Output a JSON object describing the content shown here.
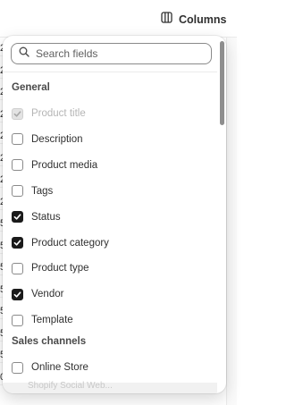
{
  "toolbar": {
    "columns_label": "Columns",
    "columns_icon": "columns-icon"
  },
  "background_edge_digits": [
    "2",
    "2",
    "2",
    "2",
    "2",
    "2",
    "2",
    "2",
    "5",
    "5",
    "5",
    "5",
    "5",
    "5",
    "5",
    "0.00"
  ],
  "popover": {
    "search": {
      "placeholder": "Search fields",
      "value": ""
    },
    "sections": [
      {
        "title": "General",
        "items": [
          {
            "label": "Product title",
            "checked": true,
            "disabled": true
          },
          {
            "label": "Description",
            "checked": false,
            "disabled": false
          },
          {
            "label": "Product media",
            "checked": false,
            "disabled": false
          },
          {
            "label": "Tags",
            "checked": false,
            "disabled": false
          },
          {
            "label": "Status",
            "checked": true,
            "disabled": false
          },
          {
            "label": "Product category",
            "checked": true,
            "disabled": false
          },
          {
            "label": "Product type",
            "checked": false,
            "disabled": false
          },
          {
            "label": "Vendor",
            "checked": true,
            "disabled": false
          },
          {
            "label": "Template",
            "checked": false,
            "disabled": false
          }
        ]
      },
      {
        "title": "Sales channels",
        "items": [
          {
            "label": "Online Store",
            "checked": false,
            "disabled": false
          }
        ]
      }
    ],
    "cutoff_text": "Shopify Social Web..."
  },
  "colors": {
    "checked": "#1a1a1a",
    "text": "#303030",
    "muted": "#b5b5b5"
  }
}
